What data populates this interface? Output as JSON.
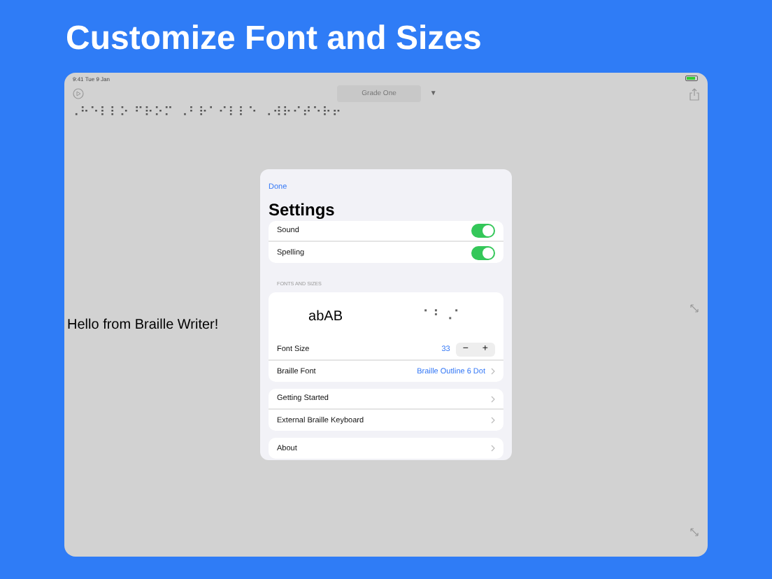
{
  "headline": "Customize Font and Sizes",
  "status_bar": {
    "time": "9:41",
    "date": "Tue 9 Jan"
  },
  "toolbar": {
    "picker": "Grade One",
    "picker_caret": "▼"
  },
  "braille_line": "⠠⠓⠑⠇⠇⠕ ⠋⠗⠕⠍ ⠠⠃⠗⠁⠊⠇⠇⠑ ⠠⠺⠗⠊⠞⠑⠗⠖",
  "document_text": "Hello from Braille Writer!",
  "settings": {
    "done": "Done",
    "title": "Settings",
    "toggles": [
      {
        "label": "Sound",
        "on": true
      },
      {
        "label": "Spelling",
        "on": true
      }
    ],
    "section_header": "FONTS AND SIZES",
    "preview": {
      "text": "abAB",
      "braille": "⠁⠃⠠⠁"
    },
    "font_size": {
      "label": "Font Size",
      "value": "33",
      "minus": "−",
      "plus": "+"
    },
    "braille_font": {
      "label": "Braille Font",
      "value": "Braille Outline 6 Dot"
    },
    "links": [
      {
        "label": "Getting Started"
      },
      {
        "label": "External Braille Keyboard"
      }
    ],
    "about": "About"
  }
}
